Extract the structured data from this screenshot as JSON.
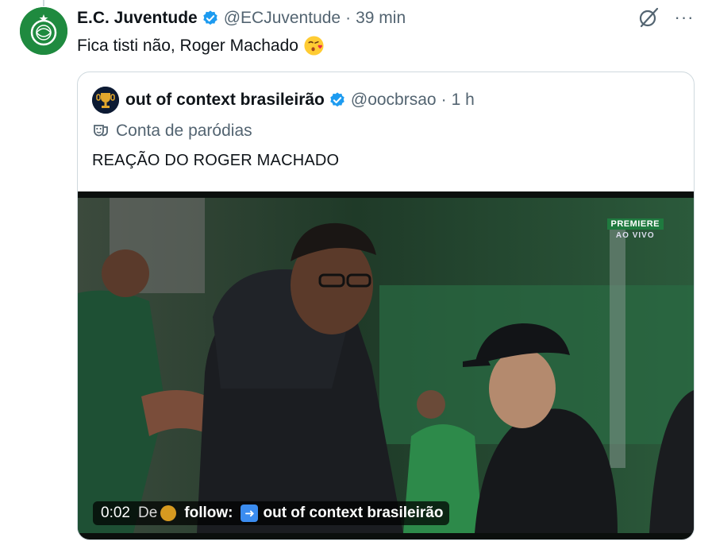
{
  "tweet": {
    "author_name": "E.C. Juventude",
    "handle": "@ECJuventude",
    "separator": "·",
    "time": "39 min",
    "text": "Fica tisti não, Roger Machado",
    "emoji": "kissing-face-emoji"
  },
  "actions": {
    "grok_icon": "grok-icon",
    "more_label": "···"
  },
  "quoted": {
    "author_name": "out of context brasileirão",
    "handle": "@oocbrsao",
    "separator": "·",
    "time": "1 h",
    "label": "Conta de paródias",
    "text": "REAÇÃO DO ROGER MACHADO",
    "video": {
      "broadcaster": "PREMIERE",
      "broadcast_status": "AO VIVO",
      "timestamp": "0:02",
      "source_prefix": "De",
      "follow_label": "follow:",
      "source_name": "out of context brasileirão"
    }
  },
  "colors": {
    "verified": "#1d9bf0",
    "muted": "#536471",
    "border": "#cfd9de",
    "juventude_green": "#1f8a3f"
  }
}
